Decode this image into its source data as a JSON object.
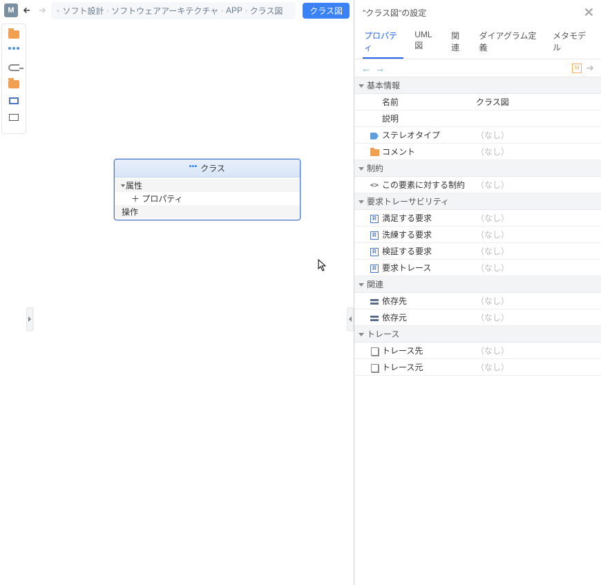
{
  "topbar": {
    "m_label": "M",
    "crumbs": [
      "ソフト設計",
      "ソフトウェアアーキテクチャ",
      "APP",
      "クラス図"
    ],
    "type_badge": "クラス図"
  },
  "toolbar": {
    "icons": [
      "folder-icon",
      "class-icon",
      "key-icon",
      "folder-icon",
      "interface-icon",
      "blank-icon"
    ]
  },
  "class_box": {
    "title": "クラス",
    "attr_header": "属性",
    "prop_item": "＋ プロパティ",
    "op_header": "操作"
  },
  "panel": {
    "title": "\"クラス図\"の設定",
    "tabs": [
      "プロパティ",
      "UML図",
      "関連",
      "ダイアグラム定義",
      "メタモデル"
    ],
    "groups": [
      {
        "label": "基本情報",
        "rows": [
          {
            "icon": null,
            "key": "名前",
            "val": "クラス図",
            "placeholder": false
          },
          {
            "icon": null,
            "key": "説明",
            "val": "",
            "placeholder": false
          },
          {
            "icon": "tag",
            "key": "ステレオタイプ",
            "val": "（なし）",
            "placeholder": true
          },
          {
            "icon": "folder",
            "key": "コメント",
            "val": "（なし）",
            "placeholder": true
          }
        ]
      },
      {
        "label": "制約",
        "rows": [
          {
            "icon": "code",
            "key": "この要素に対する制約",
            "val": "（なし）",
            "placeholder": true
          }
        ]
      },
      {
        "label": "要求トレーサビリティ",
        "rows": [
          {
            "icon": "r",
            "key": "満足する要求",
            "val": "（なし）",
            "placeholder": true
          },
          {
            "icon": "r",
            "key": "洗練する要求",
            "val": "（なし）",
            "placeholder": true
          },
          {
            "icon": "r",
            "key": "検証する要求",
            "val": "（なし）",
            "placeholder": true
          },
          {
            "icon": "r",
            "key": "要求トレース",
            "val": "（なし）",
            "placeholder": true
          }
        ]
      },
      {
        "label": "関連",
        "rows": [
          {
            "icon": "dep",
            "key": "依存先",
            "val": "（なし）",
            "placeholder": true
          },
          {
            "icon": "dep",
            "key": "依存元",
            "val": "（なし）",
            "placeholder": true
          }
        ]
      },
      {
        "label": "トレース",
        "rows": [
          {
            "icon": "doc",
            "key": "トレース先",
            "val": "（なし）",
            "placeholder": true
          },
          {
            "icon": "doc",
            "key": "トレース元",
            "val": "（なし）",
            "placeholder": true
          }
        ]
      }
    ]
  }
}
